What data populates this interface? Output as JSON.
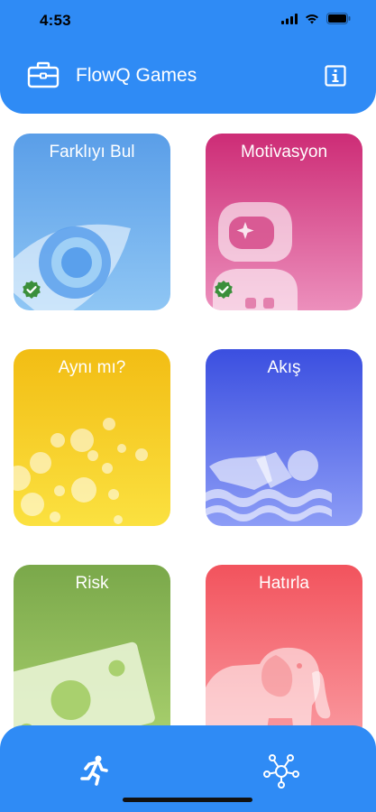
{
  "status_bar": {
    "time": "4:53"
  },
  "header": {
    "title": "FlowQ Games"
  },
  "games": [
    {
      "label": "Farklıyı Bul",
      "completed": true
    },
    {
      "label": "Motivasyon",
      "completed": true
    },
    {
      "label": "Aynı mı?",
      "completed": false
    },
    {
      "label": "Akış",
      "completed": false
    },
    {
      "label": "Risk",
      "completed": false
    },
    {
      "label": "Hatırla",
      "completed": false
    }
  ],
  "icons": {
    "header_left": "briefcase-icon",
    "header_right": "info-icon",
    "tab_1": "running-person-icon",
    "tab_2": "network-hub-icon",
    "badge": "check-badge-icon"
  },
  "colors": {
    "primary": "#2f8bf5",
    "card_1": "#5aa0ec",
    "card_2": "#cf2f78",
    "card_3": "#f2c21a",
    "card_4": "#3e55e3",
    "card_5": "#7fae4d",
    "card_6": "#f26068",
    "badge": "#3b8f3b"
  }
}
